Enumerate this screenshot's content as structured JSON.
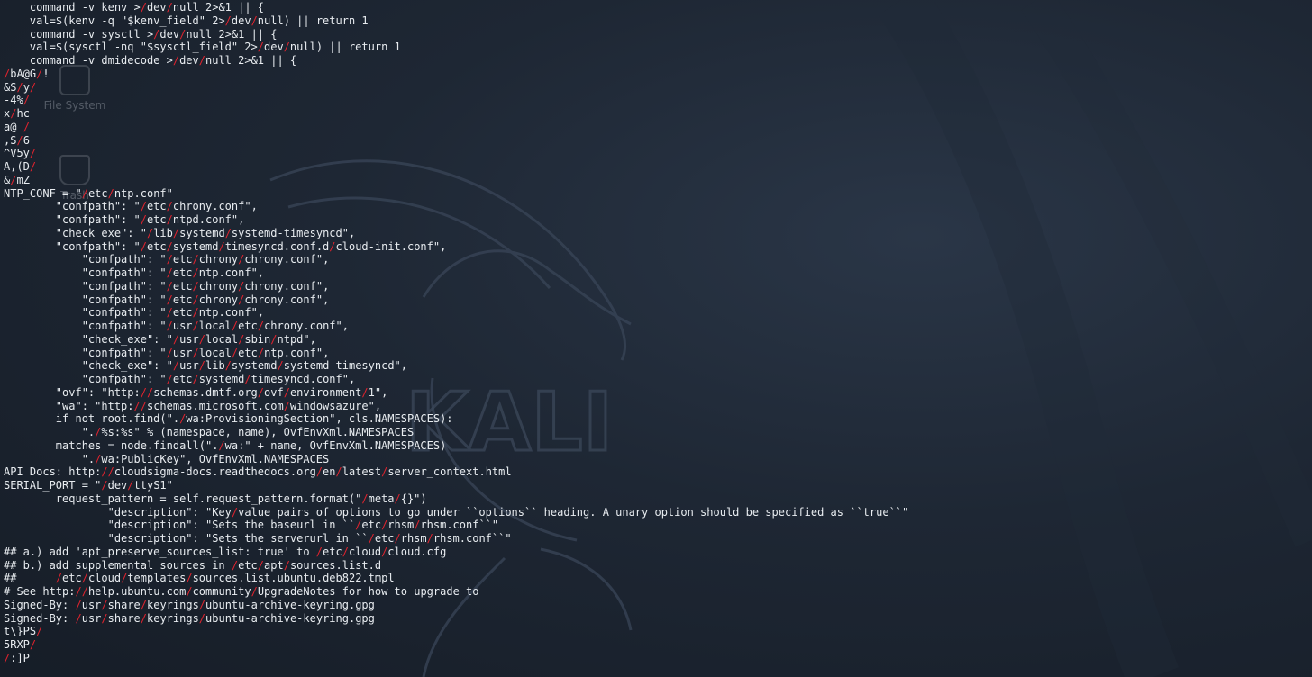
{
  "desktop": {
    "icons": [
      {
        "label": "File System",
        "icon": "drive-icon"
      },
      {
        "label": "Trash",
        "icon": "trash-icon"
      }
    ],
    "wallpaper_text": "KALI"
  },
  "colors": {
    "background": "#1b2330",
    "text": "#e8ecf0",
    "path_separator": "#e0232e"
  },
  "terminal_lines": [
    "    command -v kenv >/dev/null 2>&1 || {",
    "    val=$(kenv -q \"$kenv_field\" 2>/dev/null) || return 1",
    "    command -v sysctl >/dev/null 2>&1 || {",
    "    val=$(sysctl -nq \"$sysctl_field\" 2>/dev/null) || return 1",
    "    command -v dmidecode >/dev/null 2>&1 || {",
    "/bA@G/!",
    "&S/y/",
    "-4%/",
    "x/hc",
    "a@ /",
    ",S/6",
    "^V5y/",
    "A,(D/",
    "&/mZ",
    "NTP_CONF = \"/etc/ntp.conf\"",
    "        \"confpath\": \"/etc/chrony.conf\",",
    "        \"confpath\": \"/etc/ntpd.conf\",",
    "        \"check_exe\": \"/lib/systemd/systemd-timesyncd\",",
    "        \"confpath\": \"/etc/systemd/timesyncd.conf.d/cloud-init.conf\",",
    "            \"confpath\": \"/etc/chrony/chrony.conf\",",
    "            \"confpath\": \"/etc/ntp.conf\",",
    "            \"confpath\": \"/etc/chrony/chrony.conf\",",
    "            \"confpath\": \"/etc/chrony/chrony.conf\",",
    "            \"confpath\": \"/etc/ntp.conf\",",
    "            \"confpath\": \"/usr/local/etc/chrony.conf\",",
    "            \"check_exe\": \"/usr/local/sbin/ntpd\",",
    "            \"confpath\": \"/usr/local/etc/ntp.conf\",",
    "            \"check_exe\": \"/usr/lib/systemd/systemd-timesyncd\",",
    "            \"confpath\": \"/etc/systemd/timesyncd.conf\",",
    "        \"ovf\": \"http://schemas.dmtf.org/ovf/environment/1\",",
    "        \"wa\": \"http://schemas.microsoft.com/windowsazure\",",
    "        if not root.find(\"./wa:ProvisioningSection\", cls.NAMESPACES):",
    "            \"./%s:%s\" % (namespace, name), OvfEnvXml.NAMESPACES",
    "        matches = node.findall(\"./wa:\" + name, OvfEnvXml.NAMESPACES)",
    "            \"./wa:PublicKey\", OvfEnvXml.NAMESPACES",
    "API Docs: http://cloudsigma-docs.readthedocs.org/en/latest/server_context.html",
    "SERIAL_PORT = \"/dev/ttyS1\"",
    "        request_pattern = self.request_pattern.format(\"/meta/{}\")",
    "                \"description\": \"Key/value pairs of options to go under ``options`` heading. A unary option should be specified as ``true``\"",
    "                \"description\": \"Sets the baseurl in ``/etc/rhsm/rhsm.conf``\"",
    "                \"description\": \"Sets the serverurl in ``/etc/rhsm/rhsm.conf``\"",
    "## a.) add 'apt_preserve_sources_list: true' to /etc/cloud/cloud.cfg",
    "## b.) add supplemental sources in /etc/apt/sources.list.d",
    "##      /etc/cloud/templates/sources.list.ubuntu.deb822.tmpl",
    "# See http://help.ubuntu.com/community/UpgradeNotes for how to upgrade to",
    "Signed-By: /usr/share/keyrings/ubuntu-archive-keyring.gpg",
    "Signed-By: /usr/share/keyrings/ubuntu-archive-keyring.gpg",
    "t\\}PS/",
    "5RXP/",
    "/:]P"
  ]
}
